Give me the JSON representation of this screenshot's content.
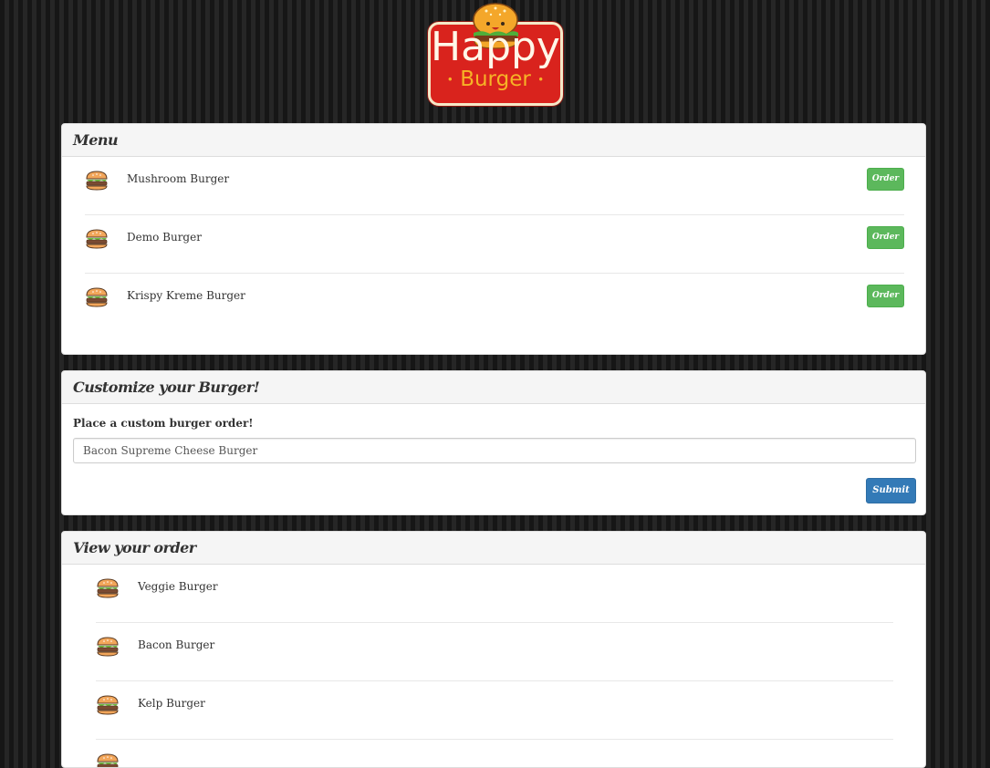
{
  "logo": {
    "line1": "Happy",
    "line2": "Burger",
    "dot": "•",
    "icon": "burger-mascot-icon"
  },
  "menu": {
    "title": "Menu",
    "order_label": "Order",
    "items": [
      {
        "name": "Mushroom Burger",
        "icon": "burger-icon"
      },
      {
        "name": "Demo Burger",
        "icon": "burger-icon"
      },
      {
        "name": "Krispy Kreme Burger",
        "icon": "burger-icon"
      }
    ]
  },
  "custom": {
    "title": "Customize your Burger!",
    "label": "Place a custom burger order!",
    "input_value": "Bacon Supreme Cheese Burger",
    "submit_label": "Submit"
  },
  "orders": {
    "title": "View your order",
    "items": [
      {
        "name": "Veggie Burger",
        "icon": "burger-icon"
      },
      {
        "name": "Bacon Burger",
        "icon": "burger-icon"
      },
      {
        "name": "Kelp Burger",
        "icon": "burger-icon"
      },
      {
        "name": "",
        "icon": "burger-icon"
      }
    ]
  },
  "colors": {
    "logo_red": "#d9231d",
    "order_green": "#5cb85c",
    "submit_blue": "#337ab7",
    "background": "#1a1a1a"
  }
}
